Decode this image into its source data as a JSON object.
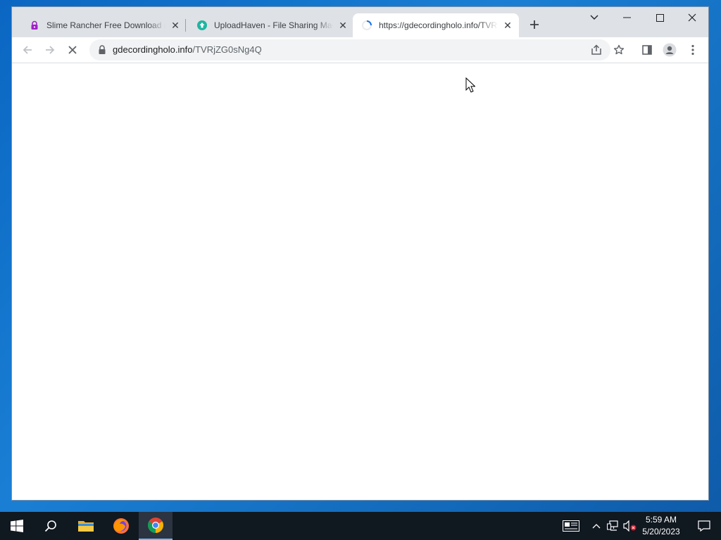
{
  "browser": {
    "tabs": [
      {
        "title": "Slime Rancher Free Download (v",
        "favicon": "purple-lock-icon",
        "active": false
      },
      {
        "title": "UploadHaven - File Sharing Mad",
        "favicon": "uploadhaven-logo-icon",
        "active": false
      },
      {
        "title": "https://gdecordingholo.info/TVR",
        "favicon": "loading-spinner-icon",
        "active": true
      }
    ],
    "new_tab_icon": "plus-icon",
    "window_controls": [
      "tab-search-icon",
      "minimize-icon",
      "maximize-icon",
      "close-icon"
    ],
    "toolbar": {
      "back_icon": "back-arrow-icon",
      "forward_icon": "forward-arrow-icon",
      "stop_icon": "stop-loading-icon",
      "url_host": "gdecordingholo.info",
      "url_path": "/TVRjZG0sNg4Q",
      "share_icon": "share-icon",
      "bookmark_icon": "star-icon",
      "side_panel_icon": "side-panel-icon",
      "profile_icon": "profile-icon",
      "menu_icon": "kebab-menu-icon"
    }
  },
  "taskbar": {
    "apps": [
      {
        "name": "start",
        "icon": "windows-start-icon"
      },
      {
        "name": "search",
        "icon": "search-icon"
      },
      {
        "name": "file-explorer",
        "icon": "folder-icon"
      },
      {
        "name": "firefox",
        "icon": "firefox-icon"
      },
      {
        "name": "chrome",
        "icon": "chrome-icon"
      }
    ],
    "tray": {
      "icons": [
        "news-widget-icon",
        "chevron-up-icon",
        "network-icon",
        "volume-muted-icon"
      ],
      "time": "5:59 AM",
      "date": "5/20/2023",
      "notifications_icon": "notification-icon"
    }
  },
  "colors": {
    "desktop_blue": "#0a66c2",
    "tabstrip": "#dee1e6",
    "omnibox": "#f1f3f4",
    "taskbar": "#101820"
  }
}
